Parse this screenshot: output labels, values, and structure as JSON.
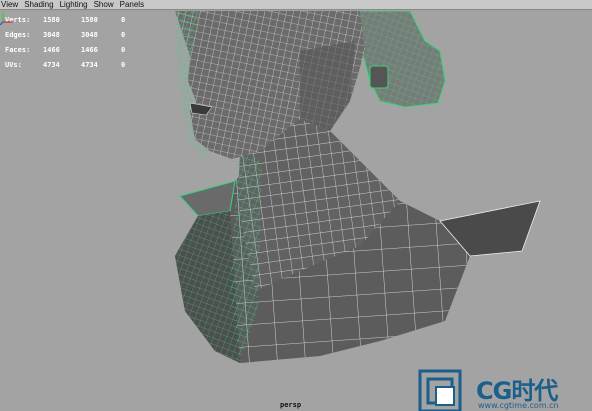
{
  "menu": {
    "items": [
      "View",
      "Shading",
      "Lighting",
      "Show",
      "Panels"
    ]
  },
  "hud": {
    "rows": [
      {
        "label": "Verts:",
        "v1": "1580",
        "v2": "1580",
        "v3": "0"
      },
      {
        "label": "Edges:",
        "v1": "3048",
        "v2": "3048",
        "v3": "0"
      },
      {
        "label": "Faces:",
        "v1": "1466",
        "v2": "1466",
        "v3": "0"
      },
      {
        "label": "UVs:",
        "v1": "4734",
        "v2": "4734",
        "v3": "0"
      }
    ]
  },
  "viewport": {
    "camera": "persp"
  },
  "watermark": {
    "title": "CG时代",
    "url": "www.cgtime.com.cn"
  },
  "colors": {
    "background": "#a3a3a3",
    "mesh_fill": "#5a5a5a",
    "wire": "#f2f2f2",
    "selection_green": "#36d47c",
    "brand": "#1b5f8c"
  }
}
